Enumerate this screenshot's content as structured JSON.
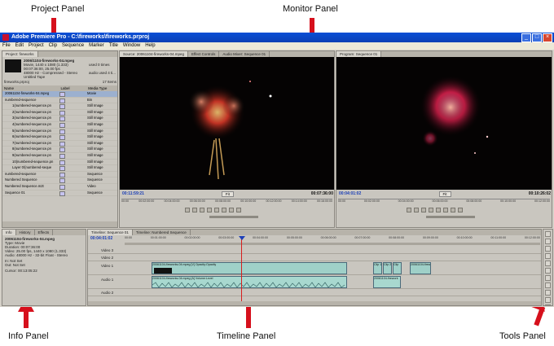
{
  "callouts": {
    "project_panel": "Project Panel",
    "monitor_panel": "Monitor Panel",
    "info_panel": "Info Panel",
    "timeline_panel": "Timeline Panel",
    "tools_panel": "Tools Panel"
  },
  "window": {
    "title": "Adobe Premiere Pro - C:\\fireworks\\fireworks.prproj",
    "buttons": [
      "_",
      "□",
      "×"
    ]
  },
  "menu": [
    "File",
    "Edit",
    "Project",
    "Clip",
    "Sequence",
    "Marker",
    "Title",
    "Window",
    "Help"
  ],
  "project": {
    "tab": "Project: fireworks",
    "clip_name": "2006/1104-fireworks-04.mpeg",
    "clip_info": [
      "Movie, 1440 x 1080 (1.333)",
      "00:07:36:00, 25.00 fps",
      "48000 Hz - Compressed - Stereo",
      "Untitled Tape"
    ],
    "used_label": "used 0 times",
    "audio_label": "audio used 4 ti...",
    "file_name": "fireworks.prproj",
    "items_count": "17 Items",
    "columns": [
      "Name",
      "Label",
      "Media Type"
    ],
    "items": [
      {
        "name": "20061104-fireworks-04.mpeg",
        "type": "Movie"
      },
      {
        "name": "numbered-sequence",
        "type": "Bin"
      },
      {
        "name": "1(numbered-sequence.pn",
        "type": "Still Image"
      },
      {
        "name": "2(numbered-sequence.pn",
        "type": "Still Image"
      },
      {
        "name": "3(numbered-sequence.pn",
        "type": "Still Image"
      },
      {
        "name": "4(numbered-sequence.pn",
        "type": "Still Image"
      },
      {
        "name": "5(numbered-sequence.pn",
        "type": "Still Image"
      },
      {
        "name": "6(numbered-sequence.pn",
        "type": "Still Image"
      },
      {
        "name": "7(numbered-sequence.pn",
        "type": "Still Image"
      },
      {
        "name": "8(numbered-sequence.pn",
        "type": "Still Image"
      },
      {
        "name": "9(numbered-sequence.pn",
        "type": "Still Image"
      },
      {
        "name": "10(numbered-sequence.pn",
        "type": "Still Image"
      },
      {
        "name": "Layer 0/(numbered-seque",
        "type": "Still Image"
      },
      {
        "name": "numbered-sequence",
        "type": "Sequence"
      },
      {
        "name": "Numbered Sequence",
        "type": "Sequence"
      },
      {
        "name": "Numbered Sequence.m2t",
        "type": "Video"
      },
      {
        "name": "Sequence 01",
        "type": "Sequence"
      }
    ]
  },
  "source_monitor": {
    "tabs": [
      "Source: 20061104-fireworks-04.mpeg",
      "Effect Controls",
      "Audio Mixer: Sequence 01"
    ],
    "timecode_left": "00:11:59:21",
    "timecode_right": "00:07:36:00",
    "fit": "Fit",
    "ruler": [
      "00:00",
      "00:02:00:00",
      "00:04:00:00",
      "00:06:00:00",
      "00:08:00:00",
      "00:10:00:00",
      "00:12:00:00",
      "00:14:00:00",
      "00:16:00:00"
    ]
  },
  "program_monitor": {
    "tab": "Program: Sequence 01",
    "timecode_left": "00:04:01:02",
    "timecode_right": "00:10:26:02",
    "fit": "Fit",
    "ruler": [
      "00:00",
      "00:02:00:00",
      "00:04:00:00",
      "00:06:00:00",
      "00:08:00:00",
      "00:10:00:00",
      "00:12:00:00"
    ]
  },
  "info": {
    "tabs": [
      "Info",
      "History",
      "Effects"
    ],
    "name": "20061104-fireworks-04.mpeg",
    "lines": [
      "Type: Movie",
      "Duration: 00:07:36:00",
      "Video: 25.00 fps, 1440 x 1080 (1.333)",
      "Audio: 48000 Hz - 32-bit Float - Stereo",
      "In: Not Set",
      "Out: Not Set",
      "Cursor: 00:13:05:22"
    ]
  },
  "timeline": {
    "tabs": [
      "Timeline: Sequence 01",
      "Timeline: Numbered Sequence"
    ],
    "timecode": "00:04:01:02",
    "ruler": [
      "00:00",
      "00:01:00:00",
      "00:02:00:00",
      "00:03:00:00",
      "00:04:00:00",
      "00:05:00:00",
      "00:06:00:00",
      "00:07:00:00",
      "00:08:00:00",
      "00:09:00:00",
      "00:10:00:00",
      "00:11:00:00",
      "00:12:00:00"
    ],
    "tracks": [
      "Video 3",
      "Video 2",
      "Video 1",
      "Audio 1",
      "Audio 2"
    ],
    "clips": {
      "v1_main": "20061104-fireworks-04.mpeg [V] Opacity:Opacity",
      "v1_c1": "Clip 1",
      "v1_c2": "Clip 2",
      "v1_c3": "Clip",
      "v1_last": "20061104-firew",
      "a1_main": "20061104-fireworks-04.mpeg [A] Volume:Level",
      "a1_end": "20061104-firework"
    }
  },
  "colors": {
    "accent": "#0b3fb5",
    "playhead": "#d81e1e",
    "video_clip": "#9fd0c8"
  }
}
